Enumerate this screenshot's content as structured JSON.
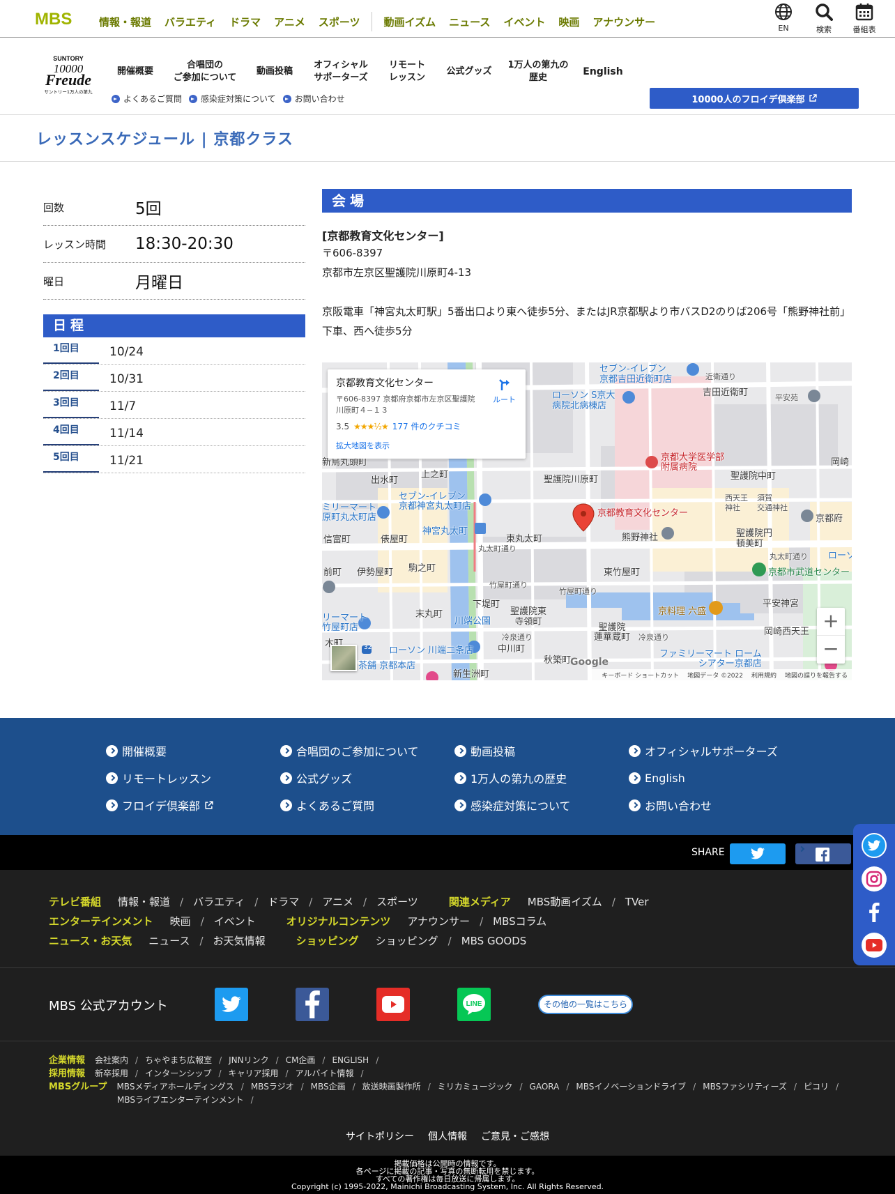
{
  "top_nav": {
    "logo": "MBS",
    "items_group1": [
      "情報・報道",
      "バラエティ",
      "ドラマ",
      "アニメ",
      "スポーツ"
    ],
    "items_group2": [
      "動画イズム",
      "ニュース",
      "イベント",
      "映画",
      "アナウンサー"
    ],
    "icons": [
      {
        "icon": "globe-icon",
        "label": "EN"
      },
      {
        "icon": "search-icon",
        "label": "検索"
      },
      {
        "icon": "calendar-icon",
        "label": "番組表"
      }
    ]
  },
  "event_header": {
    "logo_top": "SUNTORY",
    "logo_main": "10000",
    "logo_script": "Freude",
    "logo_bottom": "サントリー1万人の第九",
    "nav": [
      "開催概要",
      "合唱団の\nご参加について",
      "動画投稿",
      "オフィシャル\nサポーターズ",
      "リモート\nレッスン",
      "公式グッズ",
      "1万人の第九の\n歴史",
      "English"
    ],
    "subnav": [
      "よくあるご質問",
      "感染症対策について",
      "お問い合わせ"
    ],
    "club_button": "10000人のフロイデ倶楽部"
  },
  "page_title": "レッスンスケジュール | 京都クラス",
  "lesson_info": [
    {
      "label": "回数",
      "value": "5回"
    },
    {
      "label": "レッスン時間",
      "value": "18:30-20:30"
    },
    {
      "label": "曜日",
      "value": "月曜日"
    }
  ],
  "schedule": {
    "heading": "日程",
    "rows": [
      {
        "num": "1回目",
        "date": "10/24"
      },
      {
        "num": "2回目",
        "date": "10/31"
      },
      {
        "num": "3回目",
        "date": "11/7"
      },
      {
        "num": "4回目",
        "date": "11/14"
      },
      {
        "num": "5回目",
        "date": "11/21"
      }
    ]
  },
  "venue": {
    "heading": "会場",
    "name": "[京都教育文化センター]",
    "postal": "〒606-8397",
    "address": "京都市左京区聖護院川原町4-13",
    "access": "京阪電車「神宮丸太町駅」5番出口より東へ徒歩5分、またはJR京都駅より市バスD2のりば206号「熊野神社前」下車、西へ徒歩5分"
  },
  "map": {
    "popup_title": "京都教育文化センター",
    "popup_address": "〒606-8397 京都府京都市左京区聖護院川原町４−１３",
    "rating": "3.5",
    "stars": "★★★½★",
    "reviews": "177 件のクチコミ",
    "larger_map": "拡大地図を表示",
    "route": "ルート",
    "marker_label": "京都教育文化センター",
    "labels": {
      "seven_yoshida": "セブン-イレブン\n京都吉田近衛町店",
      "konoe_dori": "近衛通り",
      "yoshida_konoe": "吉田近衛町",
      "heianro": "平安苑",
      "lawson_s": "ローソン S京大\n病院北病棟店",
      "hospital": "京都大学医学部\n附属病院",
      "okazaki": "岡崎",
      "shimo_choja": "新烏丸頭町",
      "demizu": "出水町",
      "kaminochi": "上之町",
      "shogoin_kawara": "聖護院川原町",
      "shogoin_naka": "聖護院中町",
      "seven_jingu": "セブン-イレブン\n京都神宮丸太町店",
      "nishitenno": "西天王",
      "sugata": "須賀",
      "shrine": "神社",
      "kotsu": "交通神社",
      "kyoto_dept": "京都府",
      "family_maru": "ミリーマート\n原町丸太町店",
      "jingu_station": "神宮丸太町",
      "shinto": "信富町",
      "tawaraya": "俵屋町",
      "higashi_maruta": "東丸太町",
      "kumano": "熊野神社",
      "shogoin_en": "聖護院円\n頓美町",
      "marutamachi_dori": "丸太町通り",
      "marutamachi_dori2": "丸太町通り",
      "lawson_r": "ローソン",
      "zen": "前町",
      "iseya": "伊勢屋町",
      "komano": "駒之町",
      "higashi_takeya": "東竹屋町",
      "budo": "京都市武道センター",
      "takeyamachi": "竹屋町通り",
      "takeyamachi2": "竹屋町通り",
      "heian_miya": "平安神宮",
      "kawabata_dori": "川端通り",
      "shimodo": "下堤町",
      "suemaru": "末丸町",
      "kawabata_park": "川端公園",
      "rokkaku_restaurant": "京料理 六盛",
      "shogoin_higashi": "聖護院東\n寺領町",
      "okazaki_nishi": "岡崎西天王",
      "family_takeya": "リーマート\n竹屋町店",
      "reizen": "冷泉通り",
      "reizen2": "冷泉通り",
      "shogoin_renge": "聖護院\n蓮華蔵町",
      "lawson_kawabata": "ローソン 川端二条店",
      "kawamachi": "木町",
      "nakagawa": "中川町",
      "shusui": "秋築町",
      "family_rohm": "ファミリーマート ローム\nシアター京都店",
      "honten": "茶舗 京都本店",
      "shinsho": "新生洲町",
      "route32": "32"
    },
    "footer": [
      "キーボード ショートカット",
      "地図データ ©2022",
      "利用規約",
      "地図の誤りを報告する"
    ],
    "google": "Google",
    "zoom_in": "+",
    "zoom_out": "−"
  },
  "footer_nav": [
    "開催概要",
    "合唱団のご参加について",
    "動画投稿",
    "オフィシャルサポーターズ",
    "リモートレッスン",
    "公式グッズ",
    "1万人の第九の歴史",
    "English",
    "フロイデ倶楽部",
    "よくあるご質問",
    "感染症対策について",
    "お問い合わせ"
  ],
  "share": {
    "label": "SHARE"
  },
  "mbs_footer": {
    "row1": {
      "cat1": "テレビ番組",
      "cat1_links": [
        "情報・報道",
        "バラエティ",
        "ドラマ",
        "アニメ",
        "スポーツ"
      ],
      "cat2": "関連メディア",
      "cat2_links": [
        "MBS動画イズム",
        "TVer"
      ]
    },
    "row2": {
      "cat1": "エンターテインメント",
      "cat1_links": [
        "映画",
        "イベント"
      ],
      "cat2": "オリジナルコンテンツ",
      "cat2_links": [
        "アナウンサー",
        "MBSコラム"
      ]
    },
    "row3": {
      "cat1": "ニュース・お天気",
      "cat1_links": [
        "ニュース",
        "お天気情報"
      ],
      "cat2": "ショッピング",
      "cat2_links": [
        "ショッピング",
        "MBS GOODS"
      ]
    },
    "accounts_label": "MBS 公式アカウント",
    "others_button": "その他の一覧はこちら",
    "corp": {
      "label": "企業情報",
      "links": [
        "会社案内",
        "ちゃやまち広報室",
        "JNNリンク",
        "CM企画",
        "ENGLISH"
      ]
    },
    "recruit": {
      "label": "採用情報",
      "links": [
        "新卒採用",
        "インターンシップ",
        "キャリア採用",
        "アルバイト情報"
      ]
    },
    "group": {
      "label": "MBSグループ",
      "links": [
        "MBSメディアホールディングス",
        "MBSラジオ",
        "MBS企画",
        "放送映画製作所",
        "ミリカミュージック",
        "GAORA",
        "MBSイノベーションドライブ",
        "MBSファシリティーズ",
        "ピコリ"
      ],
      "links2": [
        "MBSライブエンターテインメント"
      ]
    },
    "policy": [
      "サイトポリシー",
      "個人情報",
      "ご意見・ご感想"
    ],
    "copyright": [
      "掲載価格は公開時の情報です。",
      "各ページに掲載の記事・写真の無断転用を禁じます。",
      "すべての著作権は毎日放送に帰属します。",
      "Copyright (c) 1995-2022, Mainichi Broadcasting System, Inc. All Rights Reserved."
    ]
  },
  "colors": {
    "accent": "#2e5cc8",
    "title": "#3a6ab8",
    "mbs_green": "#a0b400",
    "footer_blue": "#1d4f8c",
    "footer_yellow": "#d5d82b"
  }
}
